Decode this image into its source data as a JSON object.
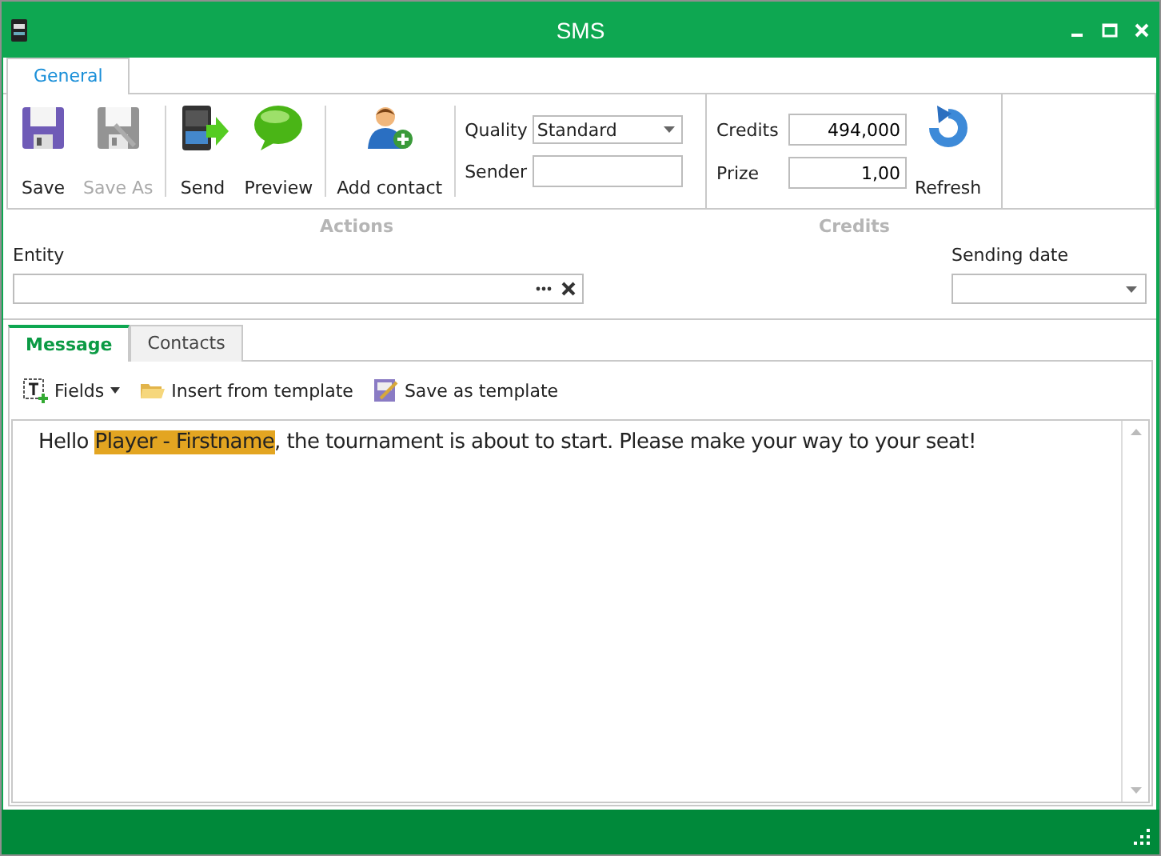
{
  "window": {
    "title": "SMS"
  },
  "ribbon_tabs": [
    {
      "label": "General",
      "selected": true
    }
  ],
  "ribbon": {
    "actions": {
      "label": "Actions",
      "button_groups": [
        [
          {
            "label": "Save",
            "disabled": false
          },
          {
            "label": "Save As",
            "disabled": true
          }
        ],
        [
          {
            "label": "Send",
            "disabled": false
          },
          {
            "label": "Preview",
            "disabled": false
          }
        ],
        [
          {
            "label": "Add contact",
            "disabled": false
          }
        ]
      ],
      "quality": {
        "label": "Quality",
        "value": "Standard"
      },
      "sender": {
        "label": "Sender"
      }
    },
    "credits": {
      "label": "Credits",
      "fields": [
        {
          "label": "Credits",
          "value": "494,000"
        },
        {
          "label": "Prize",
          "value": "1,00"
        }
      ],
      "refresh": {
        "label": "Refresh"
      }
    }
  },
  "entity": {
    "label": "Entity"
  },
  "sending_date": {
    "label": "Sending date"
  },
  "tabs": [
    {
      "label": "Message",
      "selected": true
    },
    {
      "label": "Contacts",
      "selected": false
    }
  ],
  "toolbar": [
    {
      "label": "Fields",
      "dropdown": true
    },
    {
      "label": "Insert from template",
      "dropdown": false
    },
    {
      "label": "Save as template",
      "dropdown": false
    }
  ],
  "message": {
    "parts": [
      {
        "kind": "text",
        "text": "Hello "
      },
      {
        "kind": "field",
        "text": "Player - Firstname"
      },
      {
        "kind": "text",
        "text": ", the tournament is about to start. Please make your way to your seat!"
      }
    ]
  }
}
